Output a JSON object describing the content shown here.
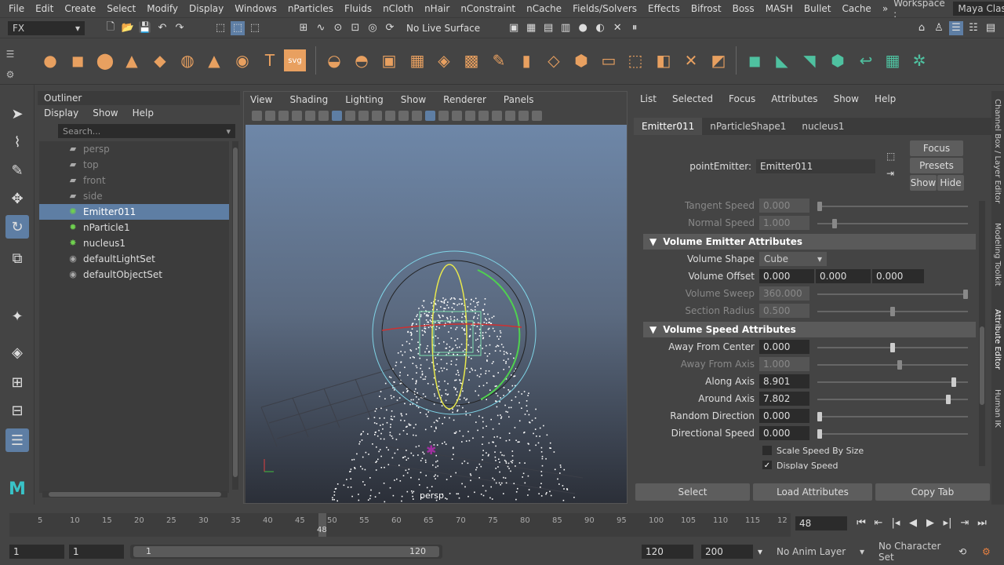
{
  "menubar": {
    "items": [
      "File",
      "Edit",
      "Create",
      "Select",
      "Modify",
      "Display",
      "Windows",
      "nParticles",
      "Fluids",
      "nCloth",
      "nHair",
      "nConstraint",
      "nCache",
      "Fields/Solvers",
      "Effects",
      "Bifrost",
      "Boss",
      "MASH",
      "Bullet",
      "Cache"
    ],
    "more": "»",
    "workspace_label": "Workspace :",
    "workspace_value": "Maya Classic"
  },
  "statusline": {
    "menu_set": "FX",
    "live_surface": "No Live Surface"
  },
  "shelf": {
    "svg_label": "svg",
    "text_label": "T"
  },
  "outliner": {
    "title": "Outliner",
    "menu": [
      "Display",
      "Show",
      "Help"
    ],
    "search_placeholder": "Search...",
    "items": [
      {
        "label": "persp",
        "dim": true
      },
      {
        "label": "top",
        "dim": true
      },
      {
        "label": "front",
        "dim": true
      },
      {
        "label": "side",
        "dim": true
      },
      {
        "label": "Emitter011",
        "sel": true
      },
      {
        "label": "nParticle1"
      },
      {
        "label": "nucleus1"
      },
      {
        "label": "defaultLightSet"
      },
      {
        "label": "defaultObjectSet"
      }
    ]
  },
  "viewport": {
    "menu": [
      "View",
      "Shading",
      "Lighting",
      "Show",
      "Renderer",
      "Panels"
    ],
    "camera_label": "persp"
  },
  "attribute_editor": {
    "menu": [
      "List",
      "Selected",
      "Focus",
      "Attributes",
      "Show",
      "Help"
    ],
    "tabs": [
      "Emitter011",
      "nParticleShape1",
      "nucleus1"
    ],
    "node_type_label": "pointEmitter:",
    "node_name": "Emitter011",
    "focus": "Focus",
    "presets": "Presets",
    "show": "Show",
    "hide": "Hide",
    "tangent_speed": {
      "label": "Tangent Speed",
      "value": "0.000",
      "level": 0.0
    },
    "normal_speed": {
      "label": "Normal Speed",
      "value": "1.000",
      "level": 0.1
    },
    "volume_emitter_header": "Volume Emitter Attributes",
    "volume_shape": {
      "label": "Volume Shape",
      "value": "Cube"
    },
    "volume_offset": {
      "label": "Volume Offset",
      "x": "0.000",
      "y": "0.000",
      "z": "0.000"
    },
    "volume_sweep": {
      "label": "Volume Sweep",
      "value": "360.000",
      "level": 1.0
    },
    "section_radius": {
      "label": "Section Radius",
      "value": "0.500",
      "level": 0.5
    },
    "volume_speed_header": "Volume Speed Attributes",
    "away_from_center": {
      "label": "Away From Center",
      "value": "0.000",
      "level": 0.5
    },
    "away_from_axis": {
      "label": "Away From Axis",
      "value": "1.000",
      "level": 0.55
    },
    "along_axis": {
      "label": "Along Axis",
      "value": "8.901",
      "level": 0.92
    },
    "around_axis": {
      "label": "Around Axis",
      "value": "7.802",
      "level": 0.88
    },
    "random_direction": {
      "label": "Random Direction",
      "value": "0.000",
      "level": 0.0
    },
    "directional_speed": {
      "label": "Directional Speed",
      "value": "0.000",
      "level": 0.0
    },
    "scale_speed_by_size": {
      "label": "Scale Speed By Size",
      "checked": false
    },
    "display_speed": {
      "label": "Display Speed",
      "checked": true
    },
    "select_btn": "Select",
    "load_attr_btn": "Load Attributes",
    "copy_tab_btn": "Copy Tab"
  },
  "sidetabs": [
    "Channel Box / Layer Editor",
    "Modeling Toolkit",
    "Attribute Editor",
    "Human IK"
  ],
  "timeline": {
    "ticks": [
      "5",
      "10",
      "15",
      "20",
      "25",
      "30",
      "35",
      "40",
      "45",
      "50",
      "55",
      "60",
      "65",
      "70",
      "75",
      "80",
      "85",
      "90",
      "95",
      "100",
      "105",
      "110",
      "115",
      "12"
    ],
    "current_frame": "48",
    "current_frame_field": "48"
  },
  "range": {
    "start": "1",
    "playback_start": "1",
    "range_start_label": "1",
    "range_end_label": "120",
    "playback_end": "120",
    "end": "200",
    "anim_layer": "No Anim Layer",
    "character_set": "No Character Set"
  },
  "colors": {
    "accent": "#5e7ea4",
    "shelf_orange": "#e8a060",
    "shelf_teal": "#4fc1a0"
  }
}
